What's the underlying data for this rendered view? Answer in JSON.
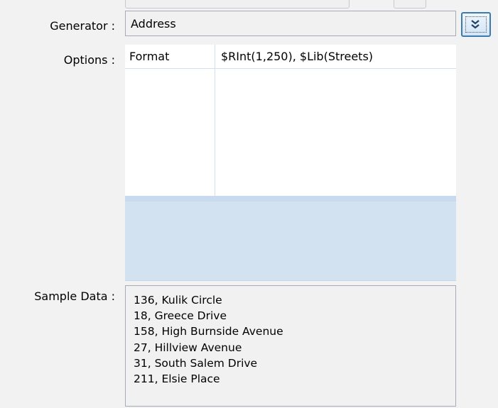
{
  "generator": {
    "label": "Generator :",
    "value": "Address",
    "expand_icon": "double-chevron-down-icon"
  },
  "options": {
    "label": "Options :",
    "rows": [
      {
        "key": "Format",
        "value": "$RInt(1,250), $Lib(Streets)"
      }
    ]
  },
  "sample_data": {
    "label": "Sample Data :",
    "lines": [
      "136, Kulik Circle",
      "18, Greece Drive",
      "158, High Burnside Avenue",
      "27, Hillview Avenue",
      "31, South Salem Drive",
      "211, Elsie Place"
    ]
  },
  "colors": {
    "background": "#f2f2f2",
    "description_panel": "#d3e2f1",
    "button_border": "#3d7bad"
  }
}
